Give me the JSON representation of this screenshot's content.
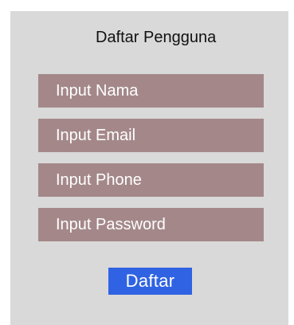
{
  "form": {
    "title": "Daftar Pengguna",
    "fields": {
      "nama": {
        "placeholder": "Input Nama",
        "value": ""
      },
      "email": {
        "placeholder": "Input Email",
        "value": ""
      },
      "phone": {
        "placeholder": "Input Phone",
        "value": ""
      },
      "password": {
        "placeholder": "Input Password",
        "value": ""
      }
    },
    "submit_label": "Daftar"
  },
  "colors": {
    "panel_background": "#d9d9d9",
    "field_background": "#a48889",
    "button_background": "#2f63e3",
    "field_text": "#ffffff"
  }
}
